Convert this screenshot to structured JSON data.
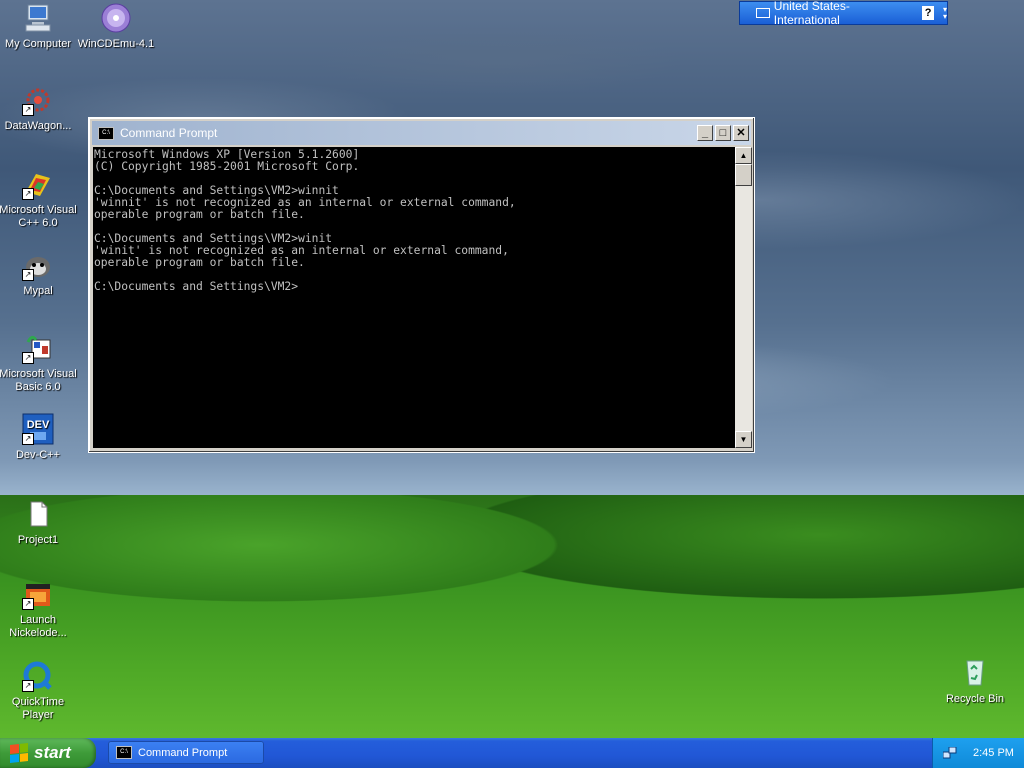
{
  "desktop": {
    "icons": [
      {
        "label": "My Computer",
        "icon": "my-computer-icon"
      },
      {
        "label": "WinCDEmu-4.1",
        "icon": "cd-emulator-icon"
      },
      {
        "label": "DataWagon...",
        "icon": "datawagon-icon"
      },
      {
        "label": "Microsoft Visual C++ 6.0",
        "icon": "visual-cpp-icon"
      },
      {
        "label": "Mypal",
        "icon": "mypal-icon"
      },
      {
        "label": "Microsoft Visual Basic 6.0",
        "icon": "visual-basic-icon"
      },
      {
        "label": "Dev-C++",
        "icon": "dev-cpp-icon"
      },
      {
        "label": "Project1",
        "icon": "document-icon"
      },
      {
        "label": "Launch Nickelode...",
        "icon": "nickelodeon-icon"
      },
      {
        "label": "QuickTime Player",
        "icon": "quicktime-icon"
      }
    ],
    "recycle_bin": "Recycle Bin"
  },
  "language_bar": {
    "language": "United States-International",
    "help": "?"
  },
  "window": {
    "title": "Command Prompt",
    "console_text": "Microsoft Windows XP [Version 5.1.2600]\n(C) Copyright 1985-2001 Microsoft Corp.\n\nC:\\Documents and Settings\\VM2>winnit\n'winnit' is not recognized as an internal or external command,\noperable program or batch file.\n\nC:\\Documents and Settings\\VM2>winit\n'winit' is not recognized as an internal or external command,\noperable program or batch file.\n\nC:\\Documents and Settings\\VM2>",
    "minimize": "_",
    "maximize": "□",
    "close": "✕"
  },
  "taskbar": {
    "start_label": "start",
    "task_label": "Command Prompt",
    "clock": "2:45 PM"
  },
  "colors": {
    "taskbar": "#245edb",
    "start": "#3e9b39",
    "console_bg": "#000000",
    "console_fg": "#c0c0c0"
  }
}
